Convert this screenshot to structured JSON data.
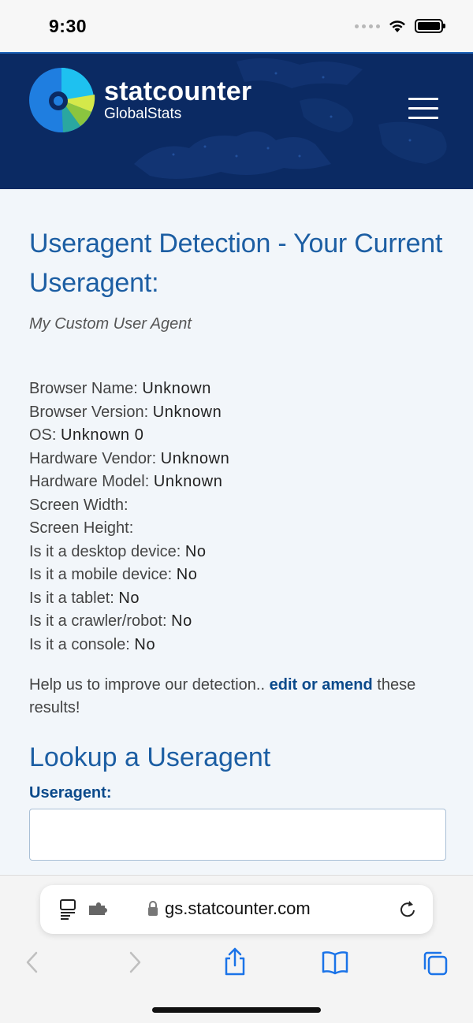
{
  "status_bar": {
    "time": "9:30"
  },
  "header": {
    "logo_title": "statcounter",
    "logo_subtitle": "GlobalStats",
    "menu_icon": "hamburger-menu-icon"
  },
  "main": {
    "title": "Useragent Detection - Your Current Useragent:",
    "useragent": "My Custom User Agent",
    "info": [
      {
        "label": "Browser Name: ",
        "value": "Unknown"
      },
      {
        "label": "Browser Version: ",
        "value": "Unknown"
      },
      {
        "label": "OS: ",
        "value": "Unknown 0"
      },
      {
        "label": "Hardware Vendor: ",
        "value": "Unknown"
      },
      {
        "label": "Hardware Model: ",
        "value": "Unknown"
      },
      {
        "label": "Screen Width: ",
        "value": ""
      },
      {
        "label": "Screen Height: ",
        "value": ""
      },
      {
        "label": "Is it a desktop device: ",
        "value": "No"
      },
      {
        "label": "Is it a mobile device: ",
        "value": "No"
      },
      {
        "label": "Is it a tablet: ",
        "value": "No"
      },
      {
        "label": "Is it a crawler/robot: ",
        "value": "No"
      },
      {
        "label": "Is it a console: ",
        "value": "No"
      }
    ],
    "help_prefix": "Help us to improve our detection.. ",
    "help_link": "edit or amend",
    "help_suffix": " these results!",
    "lookup_title": "Lookup a Useragent",
    "field_label": "Useragent:",
    "field_value": ""
  },
  "browser": {
    "url": "gs.statcounter.com",
    "icons": [
      "page-menu-icon",
      "extension-icon",
      "lock-icon",
      "reload-icon",
      "back-icon",
      "forward-icon",
      "share-icon",
      "bookmarks-icon",
      "tabs-icon"
    ]
  },
  "colors": {
    "header_bg": "#0b2a63",
    "title_blue": "#1c5ea3",
    "link_blue": "#0b4a8b"
  }
}
